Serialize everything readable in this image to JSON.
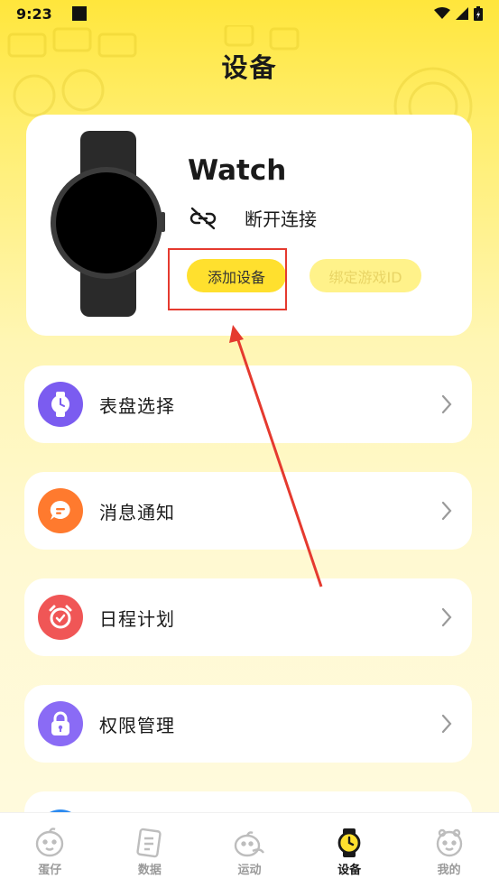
{
  "status_bar": {
    "time": "9:23"
  },
  "page": {
    "title": "设备"
  },
  "device": {
    "name": "Watch",
    "connection_status": "断开连接",
    "add_button": "添加设备",
    "bind_button": "绑定游戏ID"
  },
  "menu": [
    {
      "label": "表盘选择",
      "icon": "watch-face-icon",
      "color": "#7B5CF0"
    },
    {
      "label": "消息通知",
      "icon": "message-icon",
      "color": "#FF7A2E"
    },
    {
      "label": "日程计划",
      "icon": "alarm-clock-icon",
      "color": "#F05656"
    },
    {
      "label": "权限管理",
      "icon": "lock-icon",
      "color": "#8A6BF5"
    }
  ],
  "tabs": [
    {
      "label": "蛋仔",
      "icon": "eggy-icon",
      "active": false
    },
    {
      "label": "数据",
      "icon": "data-icon",
      "active": false
    },
    {
      "label": "运动",
      "icon": "sport-icon",
      "active": false
    },
    {
      "label": "设备",
      "icon": "watch-icon",
      "active": true
    },
    {
      "label": "我的",
      "icon": "profile-icon",
      "active": false
    }
  ],
  "colors": {
    "accent": "#FFE02E",
    "annotation": "#E53A2F"
  }
}
